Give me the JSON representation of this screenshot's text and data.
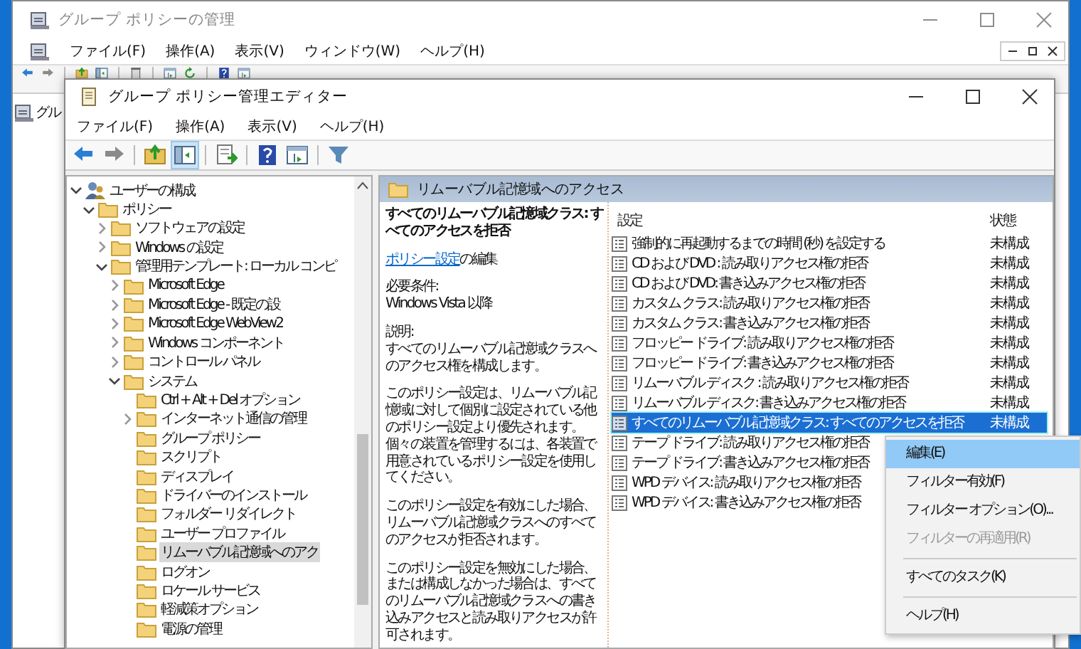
{
  "back_window": {
    "title": "グループ ポリシーの管理",
    "menu": [
      "ファイル(F)",
      "操作(A)",
      "表示(V)",
      "ウィンドウ(W)",
      "ヘルプ(H)"
    ],
    "tree_fragment": "グル"
  },
  "window": {
    "title": "グループ ポリシー管理エディター",
    "menu": [
      "ファイル(F)",
      "操作(A)",
      "表示(V)",
      "ヘルプ(H)"
    ]
  },
  "tree": [
    {
      "label": "ユーザーの構成",
      "kind": "root",
      "expanded": true,
      "selected": false,
      "children": [
        {
          "label": "ポリシー",
          "kind": "branch",
          "expanded": true,
          "selected": false,
          "children": [
            {
              "label": "ソフトウェアの設定",
              "kind": "branch",
              "expanded": false,
              "selected": false
            },
            {
              "label": "Windows の設定",
              "kind": "branch",
              "expanded": false,
              "selected": false
            },
            {
              "label": "管理用テンプレート: ローカル コンピ",
              "kind": "branch",
              "expanded": true,
              "selected": false,
              "children": [
                {
                  "label": "Microsoft Edge",
                  "kind": "branch",
                  "expanded": false,
                  "selected": false
                },
                {
                  "label": "Microsoft Edge - 既定の設",
                  "kind": "branch",
                  "expanded": false,
                  "selected": false
                },
                {
                  "label": "Microsoft Edge WebView2",
                  "kind": "branch",
                  "expanded": false,
                  "selected": false
                },
                {
                  "label": "Windows コンポーネント",
                  "kind": "branch",
                  "expanded": false,
                  "selected": false
                },
                {
                  "label": "コントロール パネル",
                  "kind": "branch",
                  "expanded": false,
                  "selected": false
                },
                {
                  "label": "システム",
                  "kind": "branch",
                  "expanded": true,
                  "selected": false,
                  "children": [
                    {
                      "label": "Ctrl + Alt + Del オプション",
                      "kind": "leaf",
                      "selected": false
                    },
                    {
                      "label": "インターネット通信の管理",
                      "kind": "branch",
                      "expanded": false,
                      "selected": false
                    },
                    {
                      "label": "グループ ポリシー",
                      "kind": "leaf",
                      "selected": false
                    },
                    {
                      "label": "スクリプト",
                      "kind": "leaf",
                      "selected": false
                    },
                    {
                      "label": "ディスプレイ",
                      "kind": "leaf",
                      "selected": false
                    },
                    {
                      "label": "ドライバーのインストール",
                      "kind": "leaf",
                      "selected": false
                    },
                    {
                      "label": "フォルダー リダイレクト",
                      "kind": "leaf",
                      "selected": false
                    },
                    {
                      "label": "ユーザー プロファイル",
                      "kind": "leaf",
                      "selected": false
                    },
                    {
                      "label": "リムーバブル記憶域へのアク",
                      "kind": "leaf",
                      "selected": true
                    },
                    {
                      "label": "ログオン",
                      "kind": "leaf",
                      "selected": false
                    },
                    {
                      "label": "ロケール サービス",
                      "kind": "leaf",
                      "selected": false
                    },
                    {
                      "label": "軽減策オプション",
                      "kind": "leaf",
                      "selected": false
                    },
                    {
                      "label": "電源の管理",
                      "kind": "leaf",
                      "selected": false
                    }
                  ]
                }
              ]
            }
          ]
        }
      ]
    }
  ],
  "details": {
    "header": "リムーバブル記憶域へのアクセス",
    "policy_title": "すべてのリムーバブル記憶域クラス: すべてのアクセスを拒否",
    "edit_link": "ポリシー設定",
    "edit_suffix": "の編集",
    "requirements_label": "必要条件:",
    "requirements": "Windows Vista 以降",
    "description_label": "説明:",
    "paragraphs": [
      "すべてのリムーバブル記憶域クラスへのアクセス権を構成します。",
      "このポリシー設定は、リムーバブル記憶域に対して個別に設定されている他のポリシー設定より優先されます。個々の装置を管理するには、各装置で用意されているポリシー設定を使用してください。",
      "このポリシー設定を有効にした場合、リムーバブル記憶域クラスへのすべてのアクセスが拒否されます。",
      "このポリシー設定を無効にした場合、または構成しなかった場合は、すべてのリムーバブル記憶域クラスへの書き込みアクセスと読み取りアクセスが許可されます。"
    ]
  },
  "settings": {
    "columns": [
      "設定",
      "状態"
    ],
    "rows": [
      {
        "name": "強制的に再起動するまでの時間 (秒) を設定する",
        "state": "未構成",
        "selected": false
      },
      {
        "name": "CD および DVD : 読み取りアクセス権の拒否",
        "state": "未構成",
        "selected": false
      },
      {
        "name": "CD および DVD: 書き込みアクセス権の拒否",
        "state": "未構成",
        "selected": false
      },
      {
        "name": "カスタム クラス: 読み取りアクセス権の拒否",
        "state": "未構成",
        "selected": false
      },
      {
        "name": "カスタム クラス: 書き込みアクセス権の拒否",
        "state": "未構成",
        "selected": false
      },
      {
        "name": "フロッピー ドライブ: 読み取りアクセス権の拒否",
        "state": "未構成",
        "selected": false
      },
      {
        "name": "フロッピー ドライブ: 書き込みアクセス権の拒否",
        "state": "未構成",
        "selected": false
      },
      {
        "name": "リムーバブル ディスク : 読み取りアクセス権の拒否",
        "state": "未構成",
        "selected": false
      },
      {
        "name": "リムーバブル ディスク: 書き込みアクセス権の拒否",
        "state": "未構成",
        "selected": false
      },
      {
        "name": "すべてのリムーバブル記憶域クラス: すべてのアクセスを拒否",
        "state": "未構成",
        "selected": true
      },
      {
        "name": "テープ ドライブ: 読み取りアクセス権の拒否",
        "selected": false
      },
      {
        "name": "テープ ドライブ: 書き込みアクセス権の拒否",
        "selected": false
      },
      {
        "name": "WPD デバイス: 読み取りアクセス権の拒否",
        "selected": false
      },
      {
        "name": "WPD デバイス: 書き込みアクセス権の拒否",
        "selected": false
      }
    ]
  },
  "context_menu": [
    {
      "kind": "item",
      "label": "編集(E)",
      "selected": true,
      "disabled": false
    },
    {
      "kind": "item",
      "label": "フィルター有効(F)",
      "selected": false,
      "disabled": false
    },
    {
      "kind": "item",
      "label": "フィルター オプション(O)...",
      "selected": false,
      "disabled": false
    },
    {
      "kind": "item",
      "label": "フィルターの再適用(R)",
      "selected": false,
      "disabled": true
    },
    {
      "kind": "separator"
    },
    {
      "kind": "item",
      "label": "すべてのタスク(K)",
      "selected": false,
      "disabled": false
    },
    {
      "kind": "separator"
    },
    {
      "kind": "item",
      "label": "ヘルプ(H)",
      "selected": false,
      "disabled": false
    }
  ]
}
